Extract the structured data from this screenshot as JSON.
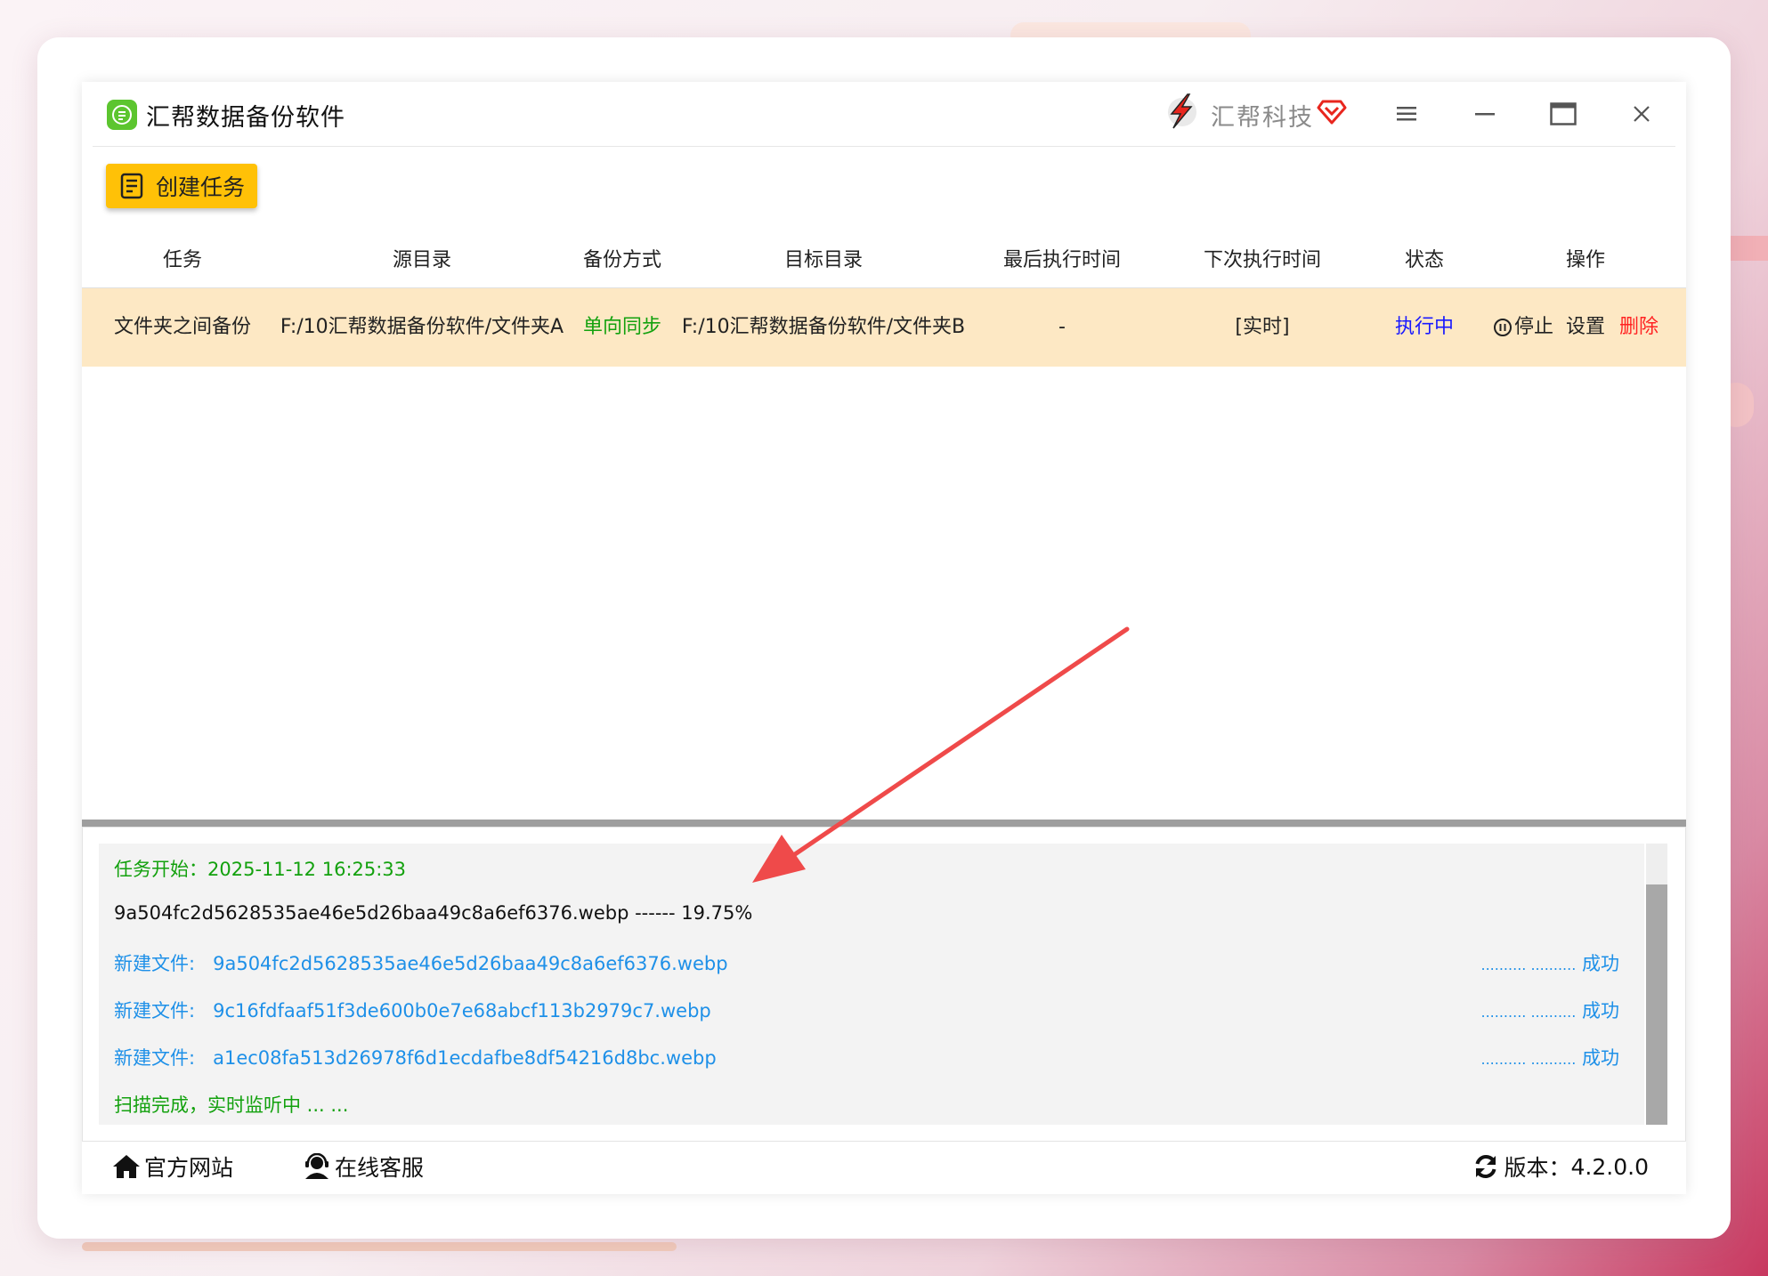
{
  "app": {
    "title": "汇帮数据备份软件",
    "brand": "汇帮科技"
  },
  "toolbar": {
    "create_label": "创建任务"
  },
  "table": {
    "headers": [
      "任务",
      "源目录",
      "备份方式",
      "目标目录",
      "最后执行时间",
      "下次执行时间",
      "状态",
      "操作"
    ],
    "rows": [
      {
        "task": "文件夹之间备份",
        "source": "F:/10汇帮数据备份软件/文件夹A",
        "mode": "单向同步",
        "target": "F:/10汇帮数据备份软件/文件夹B",
        "last_run": "-",
        "next_run": "[实时]",
        "status": "执行中",
        "op_stop": "停止",
        "op_settings": "设置",
        "op_delete": "删除"
      }
    ]
  },
  "log": {
    "start_line": "任务开始：2025-11-12 16:25:33",
    "progress_line": "9a504fc2d5628535ae46e5d26baa49c8a6ef6376.webp ------ 19.75%",
    "entries": [
      {
        "prefix": "新建文件:",
        "file": "9a504fc2d5628535ae46e5d26baa49c8a6ef6376.webp",
        "dots": ".......... ..........",
        "result": "成功"
      },
      {
        "prefix": "新建文件:",
        "file": "9c16fdfaaf51f3de600b0e7e68abcf113b2979c7.webp",
        "dots": ".......... ..........",
        "result": "成功"
      },
      {
        "prefix": "新建文件:",
        "file": "a1ec08fa513d26978f6d1ecdafbe8df54216d8bc.webp",
        "dots": ".......... ..........",
        "result": "成功"
      }
    ],
    "end_line": "扫描完成，实时监听中 ... ..."
  },
  "footer": {
    "website": "官方网站",
    "support": "在线客服",
    "version_label": "版本：",
    "version_value": "4.2.0.0"
  },
  "colors": {
    "accent_yellow": "#ffc107",
    "row_highlight": "#fde8c4",
    "status_blue": "#1a1aff",
    "delete_red": "#ff2222",
    "mode_green": "#13a10e",
    "log_blue": "#1e90e8",
    "arrow_red": "#ef4a4a"
  }
}
